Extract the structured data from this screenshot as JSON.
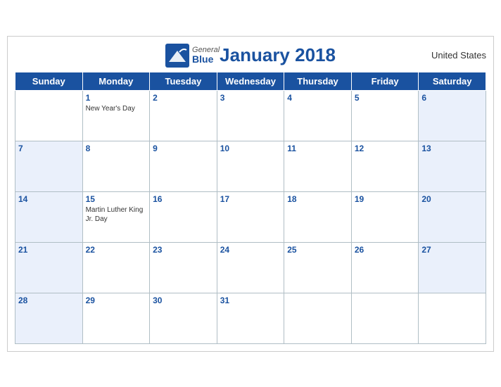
{
  "header": {
    "brand_general": "General",
    "brand_blue": "Blue",
    "title": "January 2018",
    "country": "United States"
  },
  "days_of_week": [
    "Sunday",
    "Monday",
    "Tuesday",
    "Wednesday",
    "Thursday",
    "Friday",
    "Saturday"
  ],
  "weeks": [
    [
      {
        "day": "",
        "weekend": true,
        "holiday": ""
      },
      {
        "day": "1",
        "weekend": false,
        "holiday": "New Year's Day"
      },
      {
        "day": "2",
        "weekend": false,
        "holiday": ""
      },
      {
        "day": "3",
        "weekend": false,
        "holiday": ""
      },
      {
        "day": "4",
        "weekend": false,
        "holiday": ""
      },
      {
        "day": "5",
        "weekend": false,
        "holiday": ""
      },
      {
        "day": "6",
        "weekend": true,
        "holiday": ""
      }
    ],
    [
      {
        "day": "7",
        "weekend": true,
        "holiday": ""
      },
      {
        "day": "8",
        "weekend": false,
        "holiday": ""
      },
      {
        "day": "9",
        "weekend": false,
        "holiday": ""
      },
      {
        "day": "10",
        "weekend": false,
        "holiday": ""
      },
      {
        "day": "11",
        "weekend": false,
        "holiday": ""
      },
      {
        "day": "12",
        "weekend": false,
        "holiday": ""
      },
      {
        "day": "13",
        "weekend": true,
        "holiday": ""
      }
    ],
    [
      {
        "day": "14",
        "weekend": true,
        "holiday": ""
      },
      {
        "day": "15",
        "weekend": false,
        "holiday": "Martin Luther King Jr. Day"
      },
      {
        "day": "16",
        "weekend": false,
        "holiday": ""
      },
      {
        "day": "17",
        "weekend": false,
        "holiday": ""
      },
      {
        "day": "18",
        "weekend": false,
        "holiday": ""
      },
      {
        "day": "19",
        "weekend": false,
        "holiday": ""
      },
      {
        "day": "20",
        "weekend": true,
        "holiday": ""
      }
    ],
    [
      {
        "day": "21",
        "weekend": true,
        "holiday": ""
      },
      {
        "day": "22",
        "weekend": false,
        "holiday": ""
      },
      {
        "day": "23",
        "weekend": false,
        "holiday": ""
      },
      {
        "day": "24",
        "weekend": false,
        "holiday": ""
      },
      {
        "day": "25",
        "weekend": false,
        "holiday": ""
      },
      {
        "day": "26",
        "weekend": false,
        "holiday": ""
      },
      {
        "day": "27",
        "weekend": true,
        "holiday": ""
      }
    ],
    [
      {
        "day": "28",
        "weekend": true,
        "holiday": ""
      },
      {
        "day": "29",
        "weekend": false,
        "holiday": ""
      },
      {
        "day": "30",
        "weekend": false,
        "holiday": ""
      },
      {
        "day": "31",
        "weekend": false,
        "holiday": ""
      },
      {
        "day": "",
        "weekend": false,
        "holiday": ""
      },
      {
        "day": "",
        "weekend": false,
        "holiday": ""
      },
      {
        "day": "",
        "weekend": true,
        "holiday": ""
      }
    ]
  ]
}
